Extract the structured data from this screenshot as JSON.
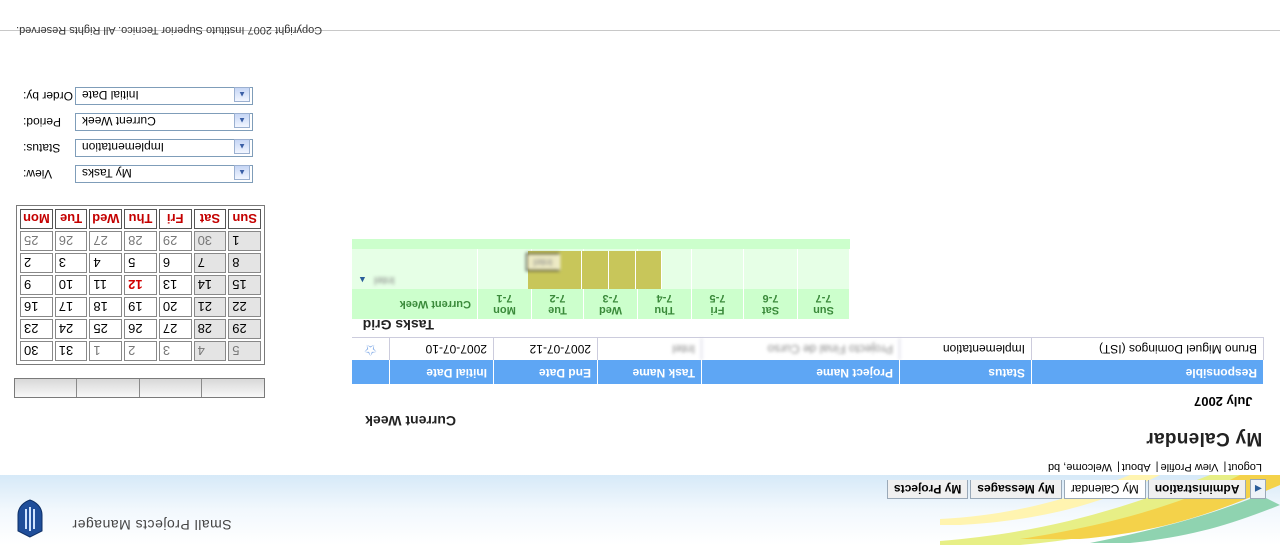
{
  "app": {
    "title": "Small Projects Manager",
    "copyright": "Copyright 2007 Instituto Superior Tecnico. All Rights Reserved."
  },
  "menu": [
    "My Projects",
    "My Messages",
    "My Calendar",
    "Administration"
  ],
  "user_links": [
    "Welcome, bd",
    "About",
    "View Profile",
    "Logout"
  ],
  "calendar": {
    "title": "My Calendar",
    "month_label": "July 2007",
    "weekdays": [
      "Mon",
      "Tue",
      "Wed",
      "Thu",
      "Fri",
      "Sat",
      "Sun"
    ],
    "weeks": [
      [
        "25",
        "26",
        "27",
        "28",
        "29",
        "30",
        "1"
      ],
      [
        "2",
        "3",
        "4",
        "5",
        "6",
        "7",
        "8"
      ],
      [
        "9",
        "10",
        "11",
        "12",
        "13",
        "14",
        "15"
      ],
      [
        "16",
        "17",
        "18",
        "19",
        "20",
        "21",
        "22"
      ],
      [
        "23",
        "24",
        "25",
        "26",
        "27",
        "28",
        "29"
      ],
      [
        "30",
        "31",
        "1",
        "2",
        "3",
        "4",
        "5"
      ]
    ],
    "today": "12"
  },
  "filters": [
    {
      "label": "Order by:",
      "value": "Initial Date"
    },
    {
      "label": "Period:",
      "value": "Current Week"
    },
    {
      "label": "Status:",
      "value": "Implementation"
    },
    {
      "label": "View:",
      "value": "My Tasks"
    }
  ],
  "current_week": {
    "title": "Current Week",
    "columns": [
      "Initial Date",
      "End Date",
      "Task Name",
      "Project Name",
      "Status",
      "Responsible"
    ],
    "rows": [
      {
        "initial_date": "2007-07-10",
        "end_date": "2007-07-12",
        "task_name": "Intel",
        "project_name": "Projecto Final de Curso",
        "status": "Implementation",
        "responsible": "Bruno Miguel Domingos (IST)"
      }
    ]
  },
  "tasks_grid": {
    "title": "Tasks Grid",
    "header_label": "Current Week",
    "days": [
      {
        "date": "7-1",
        "day": "Mon"
      },
      {
        "date": "7-2",
        "day": "Tue"
      },
      {
        "date": "7-3",
        "day": "Wed"
      },
      {
        "date": "7-4",
        "day": "Thu"
      },
      {
        "date": "7-5",
        "day": "Fri"
      },
      {
        "date": "7-6",
        "day": "Sat"
      },
      {
        "date": "7-7",
        "day": "Sun"
      }
    ],
    "task_row_label": "Intel",
    "task_box_label": "Intel"
  },
  "colors": {
    "header_blue": "#5ea6f4",
    "grid_green": "#ccffcc",
    "task_olive": "#c8c65a",
    "weekend_red": "#c40000"
  }
}
